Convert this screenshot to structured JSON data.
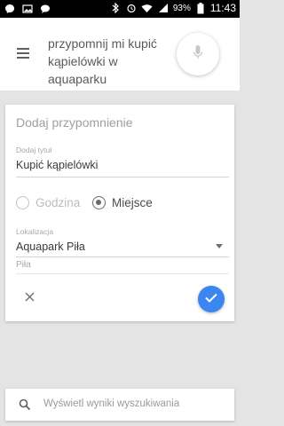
{
  "status_bar": {
    "battery_percent": "93%",
    "time": "11:43"
  },
  "header": {
    "query": "przypomnij mi kupić kąpielówki w aquaparku"
  },
  "reminder_card": {
    "title": "Dodaj przypomnienie",
    "title_field_label": "Dodaj tytuł",
    "title_value": "Kupić kąpielówki",
    "options": [
      {
        "label": "Godzina",
        "selected": false
      },
      {
        "label": "Miejsce",
        "selected": true
      }
    ],
    "location_label": "Lokalizacja",
    "location_value": "Aquapark Piła",
    "location_sub": "Piła",
    "accent_color": "#3b86f0"
  },
  "bottom_search": {
    "placeholder": "Wyświetl wyniki wyszukiwania"
  }
}
